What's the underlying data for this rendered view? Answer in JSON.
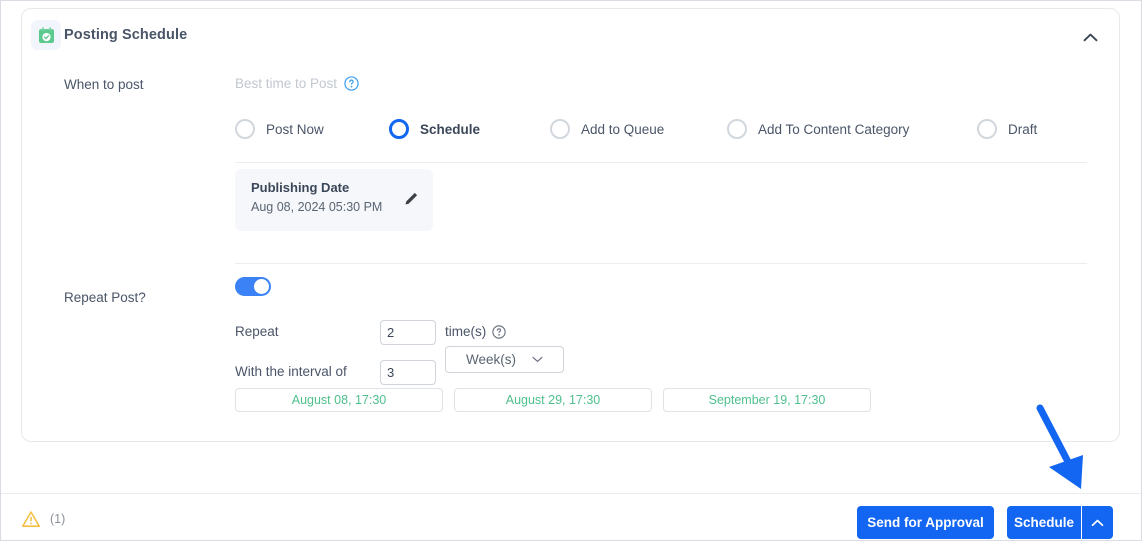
{
  "card": {
    "icon_name": "calendar-check-icon",
    "title": "Posting Schedule",
    "collapse_icon": "chevron-up-icon"
  },
  "when_to_post": {
    "label": "When to post",
    "best_time_label": "Best time to Post",
    "best_time_help_icon": "question-circle-icon",
    "options": [
      {
        "label": "Post Now",
        "selected": false
      },
      {
        "label": "Schedule",
        "selected": true
      },
      {
        "label": "Add to Queue",
        "selected": false
      },
      {
        "label": "Add To Content Category",
        "selected": false
      },
      {
        "label": "Draft",
        "selected": false
      }
    ]
  },
  "publishing_date": {
    "title": "Publishing Date",
    "value": "Aug 08, 2024 05:30 PM",
    "edit_icon": "pencil-icon"
  },
  "repeat": {
    "label": "Repeat Post?",
    "toggle_on": true,
    "repeat_label": "Repeat",
    "repeat_value": "2",
    "repeat_placeholder": "",
    "times_label": "time(s)",
    "times_help_icon": "question-circle-icon",
    "interval_label": "With the interval of",
    "interval_value": "3",
    "interval_placeholder": "",
    "unit_value": "Week(s)",
    "unit_caret_icon": "chevron-down-icon",
    "occurrences": [
      "August 08, 17:30",
      "August 29, 17:30",
      "September 19, 17:30"
    ]
  },
  "footer": {
    "warning_icon": "warning-triangle-icon",
    "warning_count": "(1)",
    "send_for_approval_label": "Send for Approval",
    "schedule_label": "Schedule",
    "schedule_caret_icon": "chevron-up-icon"
  },
  "annotation": {
    "arrow_icon": "arrow-pointer-icon",
    "color": "#1266f1"
  },
  "colors": {
    "accent": "#1266f1",
    "toggle_on": "#3b82f6",
    "chip_text": "#4fc08d",
    "icon_green": "#5cc98f",
    "warning": "#f5bf42",
    "muted_text": "#c2c8d0"
  }
}
